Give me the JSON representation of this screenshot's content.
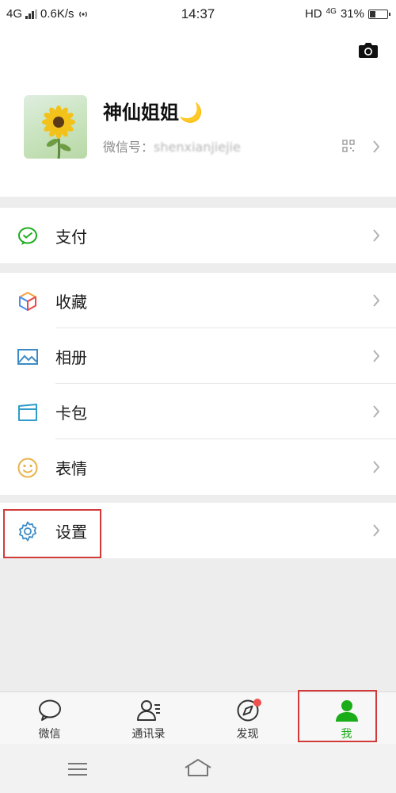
{
  "status_bar": {
    "network": "4G",
    "speed": "0.6K/s",
    "time": "14:37",
    "hd": "HD",
    "lte": "4G",
    "battery": "31%",
    "battery_level": 0.31
  },
  "profile": {
    "nickname": "神仙姐姐🌙",
    "wechat_id_label": "微信号：",
    "wechat_id_value": "shenxianjiejie"
  },
  "menu": {
    "pay": "支付",
    "favorites": "收藏",
    "album": "相册",
    "cards": "卡包",
    "stickers": "表情",
    "settings": "设置"
  },
  "tabs": [
    {
      "label": "微信",
      "icon": "chat-icon"
    },
    {
      "label": "通讯录",
      "icon": "contacts-icon"
    },
    {
      "label": "发现",
      "icon": "compass-icon"
    },
    {
      "label": "我",
      "icon": "person-icon"
    }
  ],
  "colors": {
    "accent_green": "#1aad19",
    "highlight_red": "#d23a3a",
    "badge_red": "#f24f4f"
  }
}
